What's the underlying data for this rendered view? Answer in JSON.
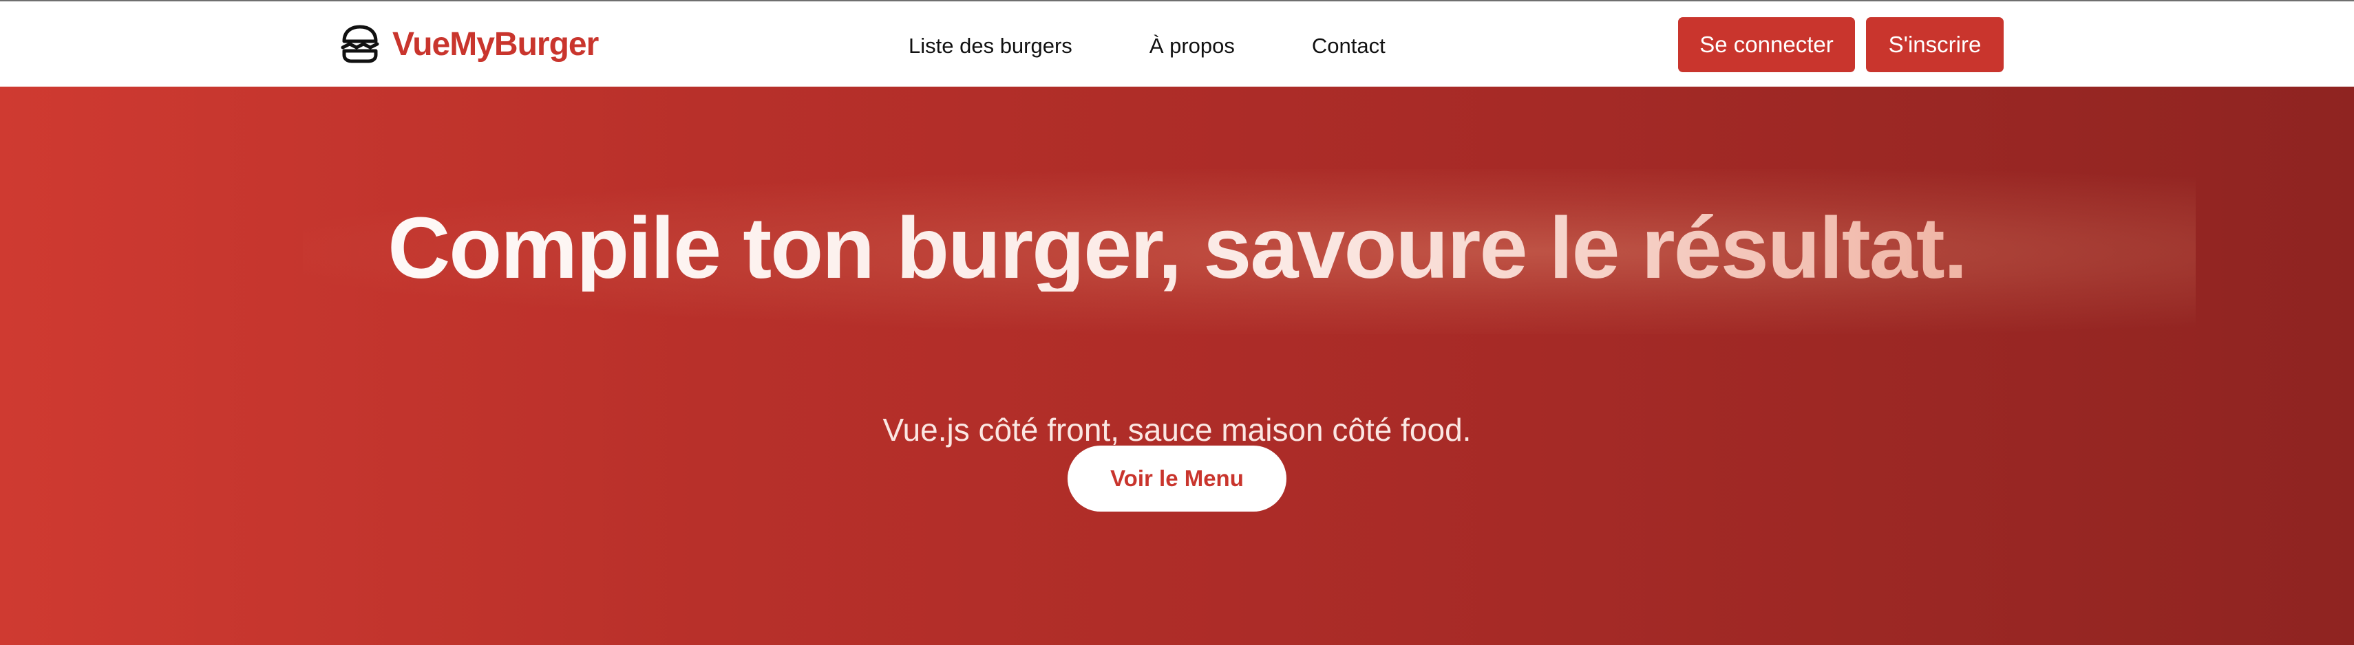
{
  "nav": {
    "brand": {
      "name": "VueMyBurger",
      "icon": "burger-icon"
    },
    "links": [
      {
        "label": "Liste des burgers"
      },
      {
        "label": "À propos"
      },
      {
        "label": "Contact"
      }
    ],
    "login_label": "Se connecter",
    "signup_label": "S'inscrire"
  },
  "hero": {
    "title": "Compile ton burger, savoure le résultat.",
    "subtitle": "Vue.js côté front, sauce maison côté food.",
    "cta_label": "Voir le Menu"
  },
  "colors": {
    "accent": "#c9352d",
    "hero_gradient_start": "#cf3a31",
    "hero_gradient_end": "#8f2421",
    "text_dark": "#111111",
    "white": "#ffffff"
  }
}
